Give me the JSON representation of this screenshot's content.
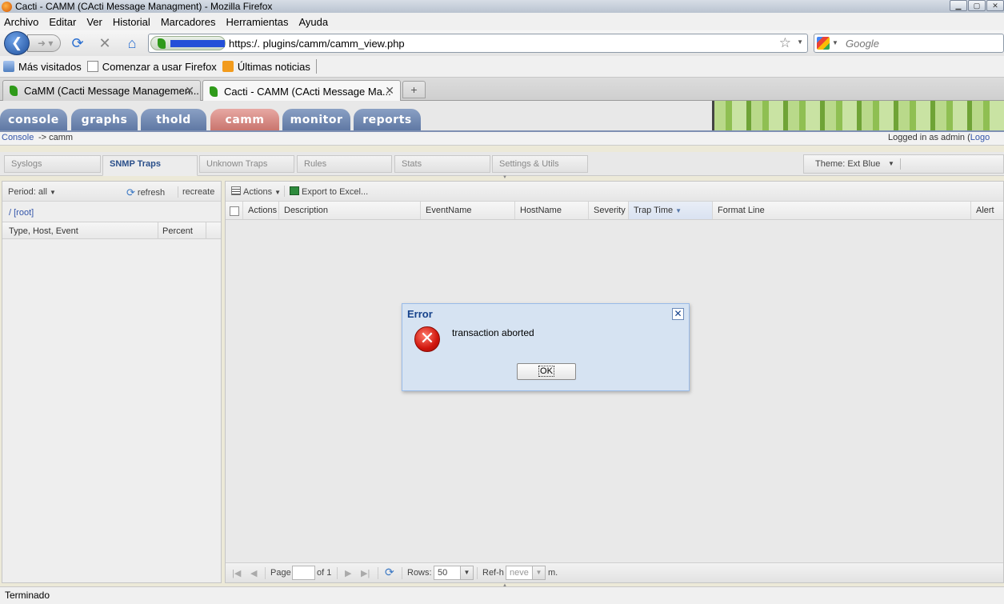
{
  "window": {
    "title": "Cacti - CAMM (CActi Message Managment) - Mozilla Firefox"
  },
  "menu": [
    "Archivo",
    "Editar",
    "Ver",
    "Historial",
    "Marcadores",
    "Herramientas",
    "Ayuda"
  ],
  "urlbar": {
    "url": "https:/.          plugins/camm/camm_view.php"
  },
  "search": {
    "placeholder": "Google"
  },
  "bookmarks": [
    "Más visitados",
    "Comenzar a usar Firefox",
    "Últimas noticias"
  ],
  "tabs": [
    {
      "label": "CaMM (Cacti Message Managemen...",
      "active": false
    },
    {
      "label": "Cacti - CAMM (CActi Message Ma...",
      "active": true
    }
  ],
  "cacti_tabs": [
    "console",
    "graphs",
    "thold",
    "camm",
    "monitor",
    "reports"
  ],
  "cacti_selected": "camm",
  "breadcrumb": {
    "link": "Console",
    "rest": "-> camm"
  },
  "login": {
    "prefix": "Logged in as admin (",
    "link": "Logo"
  },
  "app_tabs": [
    "Syslogs",
    "SNMP Traps",
    "Unknown Traps",
    "Rules",
    "Stats",
    "Settings & Utils"
  ],
  "app_selected": "SNMP Traps",
  "theme": {
    "label": "Theme: Ext Blue"
  },
  "left_panel": {
    "period": "Period: all",
    "refresh": "refresh",
    "recreate": "recreate",
    "path": "/ [root]",
    "columns": [
      "Type, Host, Event",
      "Percent"
    ]
  },
  "right_panel": {
    "actions": "Actions",
    "export": "Export to Excel...",
    "columns": [
      "Actions",
      "Description",
      "EventName",
      "HostName",
      "Severity",
      "Trap Time",
      "Format Line",
      "Alert"
    ],
    "sorted_column": "Trap Time"
  },
  "paging": {
    "page_label": "Page",
    "page_value": "",
    "of_label": "of 1",
    "rows_label": "Rows:",
    "rows_value": "50",
    "refresh_label": "Ref-h",
    "refresh_value": "neve",
    "unit": "m."
  },
  "dialog": {
    "title": "Error",
    "message": "transaction aborted",
    "ok": "OK"
  },
  "status": "Terminado",
  "colors": {
    "cacti_tab": "#5e77a3",
    "cacti_tab_selected": "#c8736c",
    "dialog_bg": "#d6e3f2",
    "dialog_title": "#15428b"
  }
}
